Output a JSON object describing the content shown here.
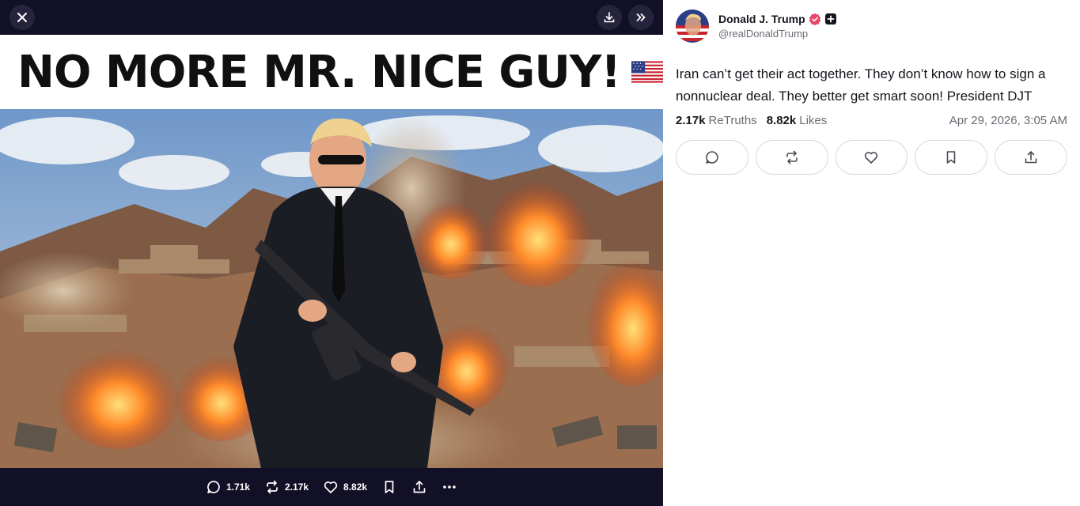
{
  "viewer": {
    "close_icon": "close-icon",
    "download_icon": "download-icon",
    "expand_icon": "double-chevron-right-icon",
    "headline": "NO MORE MR. NICE GUY!",
    "headline_emoji": "us-flag",
    "actions": {
      "replies": "1.71k",
      "retruths": "2.17k",
      "likes": "8.82k"
    }
  },
  "post": {
    "author_name": "Donald J. Trump",
    "handle": "@realDonaldTrump",
    "text": "Iran can’t get their act together. They don’t know how to sign a nonnuclear deal. They better get smart soon! President DJT",
    "retruths_count": "2.17k",
    "retruths_label": "ReTruths",
    "likes_count": "8.82k",
    "likes_label": "Likes",
    "date": "Apr 29, 2026, 3:05 AM"
  },
  "colors": {
    "viewer_bg": "#121026",
    "verified": "#e8476b",
    "text": "#16141c",
    "muted": "#6b6a75",
    "border": "#d6d5dc"
  }
}
